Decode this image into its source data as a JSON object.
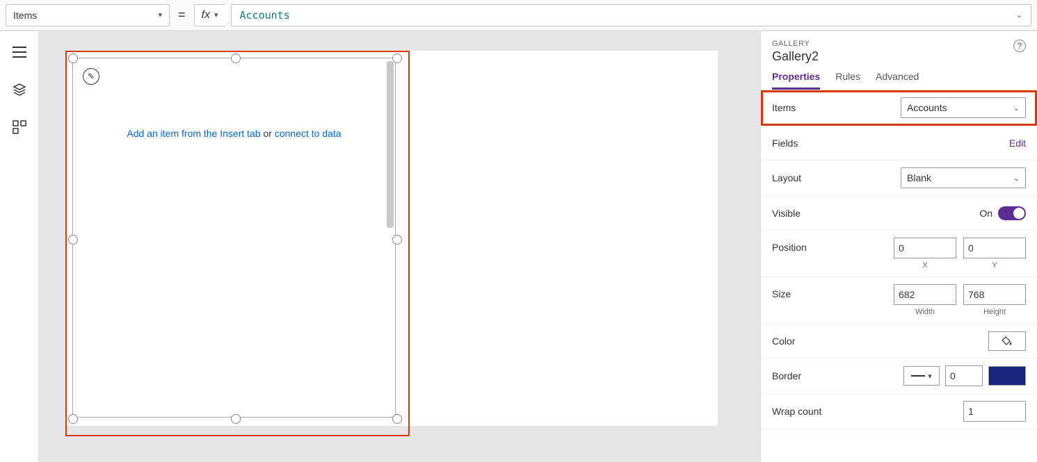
{
  "formulaBar": {
    "property": "Items",
    "equals": "=",
    "fx": "fx",
    "value": "Accounts"
  },
  "canvas": {
    "hint_prefix": "Add an item from the Insert tab",
    "hint_or": " or ",
    "hint_suffix": "connect to data"
  },
  "panel": {
    "type": "GALLERY",
    "name": "Gallery2",
    "tabs": {
      "properties": "Properties",
      "rules": "Rules",
      "advanced": "Advanced"
    },
    "items": {
      "label": "Items",
      "value": "Accounts"
    },
    "fields": {
      "label": "Fields",
      "action": "Edit"
    },
    "layout": {
      "label": "Layout",
      "value": "Blank"
    },
    "visible": {
      "label": "Visible",
      "state": "On"
    },
    "position": {
      "label": "Position",
      "x": "0",
      "y": "0",
      "xl": "X",
      "yl": "Y"
    },
    "size": {
      "label": "Size",
      "w": "682",
      "h": "768",
      "wl": "Width",
      "hl": "Height"
    },
    "color": {
      "label": "Color"
    },
    "border": {
      "label": "Border",
      "width": "0"
    },
    "wrap": {
      "label": "Wrap count",
      "value": "1"
    }
  }
}
